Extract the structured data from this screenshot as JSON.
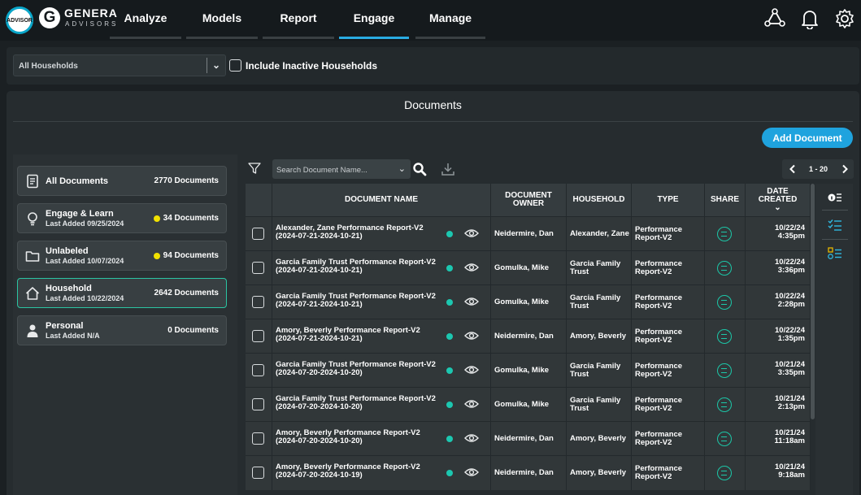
{
  "brand": {
    "badge": "ADVISOR",
    "g": "G",
    "name": "GENERA",
    "sub": "ADVISORS"
  },
  "nav": [
    "Analyze",
    "Models",
    "Report",
    "Engage",
    "Manage"
  ],
  "active_nav": "Engage",
  "filter": {
    "household_select": "All Households",
    "inactive_label": "Include Inactive Households"
  },
  "panel": {
    "title": "Documents",
    "add_button": "Add Document"
  },
  "categories": [
    {
      "title": "All Documents",
      "sub": "",
      "count": "2770 Documents",
      "dot": false
    },
    {
      "title": "Engage & Learn",
      "sub": "Last Added 09/25/2024",
      "count": "34 Documents",
      "dot": true
    },
    {
      "title": "Unlabeled",
      "sub": "Last Added 10/07/2024",
      "count": "94 Documents",
      "dot": true
    },
    {
      "title": "Household",
      "sub": "Last Added 10/22/2024",
      "count": "2642 Documents",
      "dot": false
    },
    {
      "title": "Personal",
      "sub": "Last Added N/A",
      "count": "0 Documents",
      "dot": false
    }
  ],
  "search": {
    "placeholder": "Search Document Name..."
  },
  "pager": {
    "range": "1 - 20"
  },
  "table": {
    "headers": {
      "name": "DOCUMENT NAME",
      "owner1": "DOCUMENT",
      "owner2": "OWNER",
      "household": "HOUSEHOLD",
      "type": "TYPE",
      "share": "SHARE",
      "date1": "DATE",
      "date2": "CREATED"
    },
    "rows": [
      {
        "name1": "Alexander, Zane Performance Report-V2",
        "name2": "(2024-07-21-2024-10-21)",
        "owner": "Neidermire, Dan",
        "hh1": "Alexander, Zane",
        "hh2": "",
        "type1": "Performance",
        "type2": "Report-V2",
        "d1": "10/22/24",
        "d2": "4:35pm"
      },
      {
        "name1": "Garcia Family Trust Performance Report-V2",
        "name2": "(2024-07-21-2024-10-21)",
        "owner": "Gomulka, Mike",
        "hh1": "Garcia Family",
        "hh2": "Trust",
        "type1": "Performance",
        "type2": "Report-V2",
        "d1": "10/22/24",
        "d2": "3:36pm"
      },
      {
        "name1": "Garcia Family Trust Performance Report-V2",
        "name2": "(2024-07-21-2024-10-21)",
        "owner": "Gomulka, Mike",
        "hh1": "Garcia Family",
        "hh2": "Trust",
        "type1": "Performance",
        "type2": "Report-V2",
        "d1": "10/22/24",
        "d2": "2:28pm"
      },
      {
        "name1": "Amory, Beverly Performance Report-V2",
        "name2": "(2024-07-21-2024-10-21)",
        "owner": "Neidermire, Dan",
        "hh1": "Amory, Beverly",
        "hh2": "",
        "type1": "Performance",
        "type2": "Report-V2",
        "d1": "10/22/24",
        "d2": "1:35pm"
      },
      {
        "name1": "Garcia Family Trust Performance Report-V2",
        "name2": "(2024-07-20-2024-10-20)",
        "owner": "Gomulka, Mike",
        "hh1": "Garcia Family",
        "hh2": "Trust",
        "type1": "Performance",
        "type2": "Report-V2",
        "d1": "10/21/24",
        "d2": "3:35pm"
      },
      {
        "name1": "Garcia Family Trust Performance Report-V2",
        "name2": "(2024-07-20-2024-10-20)",
        "owner": "Gomulka, Mike",
        "hh1": "Garcia Family",
        "hh2": "Trust",
        "type1": "Performance",
        "type2": "Report-V2",
        "d1": "10/21/24",
        "d2": "2:13pm"
      },
      {
        "name1": "Amory, Beverly Performance Report-V2",
        "name2": "(2024-07-20-2024-10-20)",
        "owner": "Neidermire, Dan",
        "hh1": "Amory, Beverly",
        "hh2": "",
        "type1": "Performance",
        "type2": "Report-V2",
        "d1": "10/21/24",
        "d2": "11:18am"
      },
      {
        "name1": "Amory, Beverly Performance Report-V2",
        "name2": "(2024-07-20-2024-10-19)",
        "owner": "Neidermire, Dan",
        "hh1": "Amory, Beverly",
        "hh2": "",
        "type1": "Performance",
        "type2": "Report-V2",
        "d1": "10/21/24",
        "d2": "9:18am"
      }
    ]
  }
}
